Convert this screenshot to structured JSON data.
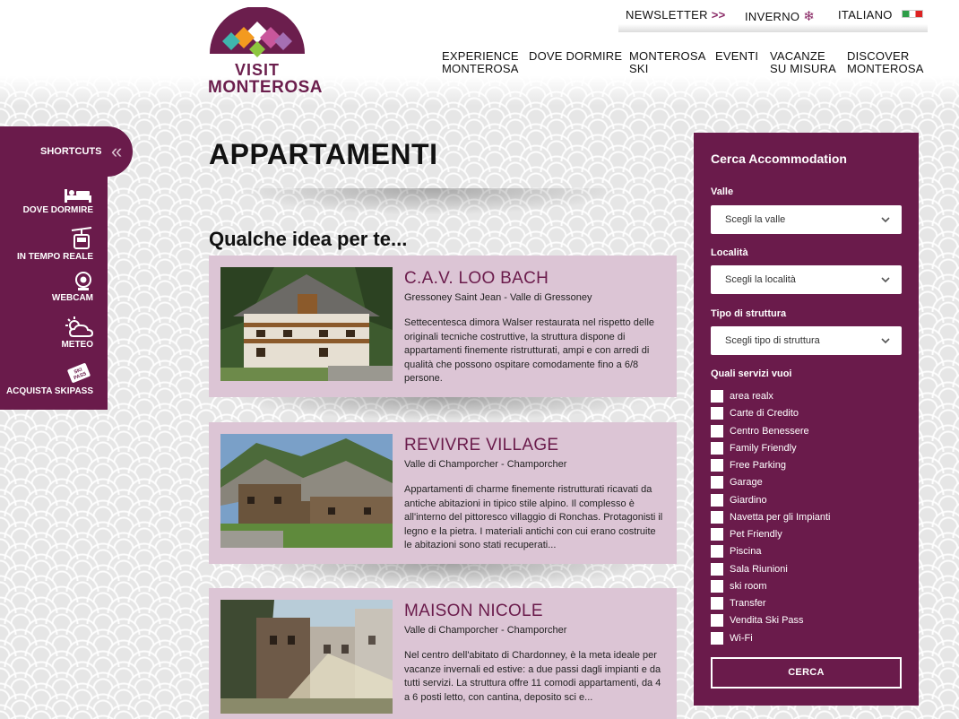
{
  "header": {
    "logo": {
      "line1": "VISIT",
      "line2": "MONTEROSA"
    },
    "top": {
      "newsletter": "NEWSLETTER",
      "newsletter_arrow": ">>",
      "season": "INVERNO",
      "language": "ITALIANO"
    },
    "nav": [
      {
        "line1": "EXPERIENCE",
        "line2": "MONTEROSA"
      },
      {
        "line1": "DOVE DORMIRE",
        "line2": ""
      },
      {
        "line1": "MONTEROSA",
        "line2": "SKI"
      },
      {
        "line1": "EVENTI",
        "line2": ""
      },
      {
        "line1": "VACANZE",
        "line2": "SU MISURA"
      },
      {
        "line1": "DISCOVER",
        "line2": "MONTEROSA"
      }
    ]
  },
  "shortcuts": {
    "title": "SHORTCUTS",
    "items": [
      {
        "label": "DOVE DORMIRE",
        "icon": "bed-icon"
      },
      {
        "label": "IN TEMPO REALE",
        "icon": "cable-car-icon"
      },
      {
        "label": "WEBCAM",
        "icon": "webcam-icon"
      },
      {
        "label": "METEO",
        "icon": "weather-icon"
      },
      {
        "label": "ACQUISTA SKIPASS",
        "icon": "skipass-icon"
      }
    ]
  },
  "main": {
    "title": "APPARTAMENTI",
    "subtitle": "Qualche idea per te...",
    "cards": [
      {
        "title": "C.A.V. LOO BACH",
        "location": "Gressoney Saint Jean - Valle di Gressoney",
        "description": "Settecentesca dimora Walser restaurata nel rispetto delle originali tecniche costruttive, la struttura dispone di appartamenti finemente ristrutturati, ampi e con arredi di qualità che possono ospitare comodamente fino a 6/8 persone."
      },
      {
        "title": "REVIVRE VILLAGE",
        "location": "Valle di Champorcher - Champorcher",
        "description": "Appartamenti di charme finemente ristrutturati ricavati da antiche abitazioni in tipico stile alpino. Il complesso è all'interno del pittoresco villaggio di Ronchas. Protagonisti il legno e la pietra. I materiali antichi con cui erano costruite le abitazioni sono stati recuperati..."
      },
      {
        "title": "MAISON NICOLE",
        "location": "Valle di Champorcher - Champorcher",
        "description": "Nel centro dell'abitato di Chardonney, è la meta ideale per vacanze invernali ed estive: a due passi dagli impianti e da tutti servizi. La struttura offre 11 comodi appartamenti, da 4 a 6 posti letto, con cantina, deposito sci e..."
      }
    ]
  },
  "search": {
    "title": "Cerca Accommodation",
    "valle_label": "Valle",
    "valle_value": "Scegli la valle",
    "localita_label": "Località",
    "localita_value": "Scegli la località",
    "tipo_label": "Tipo di struttura",
    "tipo_value": "Scegli tipo di struttura",
    "servizi_label": "Quali servizi vuoi",
    "servizi": [
      "area realx",
      "Carte di Credito",
      "Centro Benessere",
      "Family Friendly",
      "Free Parking",
      "Garage",
      "Giardino",
      "Navetta per gli Impianti",
      "Pet Friendly",
      "Piscina",
      "Sala Riunioni",
      "ski room",
      "Transfer",
      "Vendita Ski Pass",
      "Wi-Fi"
    ],
    "button": "CERCA"
  }
}
